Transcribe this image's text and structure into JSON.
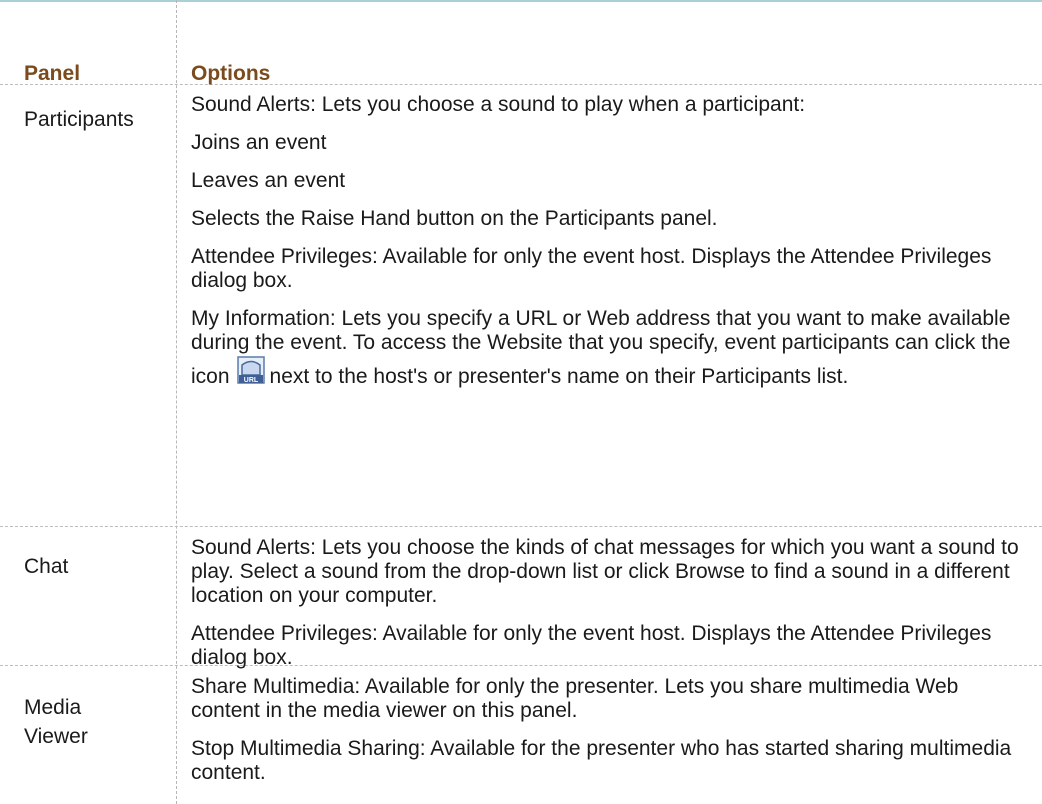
{
  "table": {
    "header": {
      "panel": "Panel",
      "options": "Options"
    },
    "rows": [
      {
        "panel": "Participants",
        "options": [
          "Sound Alerts: Lets you choose a sound to play when a participant:",
          "Joins an event",
          "Leaves an event",
          "Selects the Raise Hand button on the Participants panel.",
          "Attendee Privileges: Available for only the event host. Displays the Attendee Privileges dialog box."
        ],
        "myinfo": {
          "part1": "My Information: Lets you specify a URL or Web address that you want to make available during the event. To access the Website that you specify, event participants can click the icon",
          "part2": "next to the host's or presenter's name on their Participants list."
        }
      },
      {
        "panel": "Chat",
        "options": [
          "Sound Alerts: Lets you choose the kinds of chat messages for which you want a sound to play. Select a sound from the drop-down list or click Browse to find a sound in a different location on your computer.",
          "Attendee Privileges: Available for only the event host. Displays the Attendee Privileges dialog box."
        ]
      },
      {
        "panel": "Media Viewer",
        "options": [
          "Share Multimedia: Available for only the presenter. Lets you share multimedia Web content in the media viewer on this panel.",
          "Stop Multimedia Sharing: Available for the presenter who has started sharing multimedia content."
        ]
      }
    ]
  },
  "icons": {
    "url_icon": "url-icon"
  },
  "colors": {
    "header_text": "#7b4b1d",
    "top_rule": "#a9cfd8",
    "divider": "#bdbdbd"
  }
}
